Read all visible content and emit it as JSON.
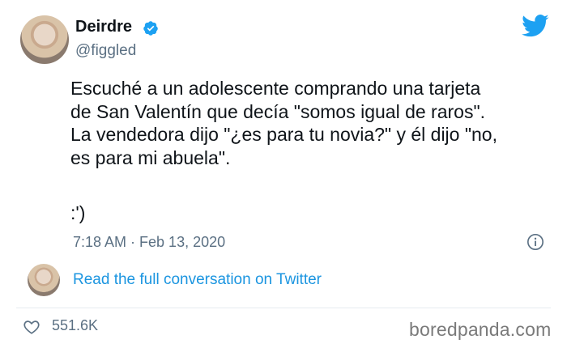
{
  "author": {
    "name": "Deirdre",
    "handle": "@figgled",
    "verified_color": "#1da1f2"
  },
  "tweet": {
    "text": "Escuché a un adolescente comprando una tarjeta\nde San Valentín que decía \"somos igual de raros\".\nLa vendedora dijo \"¿es para tu novia?\" y él dijo \"no,\nes para mi abuela\".",
    "emoticon": ":')",
    "timestamp": "7:18 AM · Feb 13, 2020"
  },
  "footer": {
    "read_link": "Read the full conversation on Twitter",
    "likes": "551.6K",
    "watermark": "boredpanda.com"
  },
  "colors": {
    "link": "#1b95e0",
    "secondary_text": "#5b7083",
    "twitter_blue": "#1da1f2"
  },
  "icons": [
    "verified-badge-icon",
    "twitter-bird-icon",
    "info-icon",
    "heart-icon"
  ]
}
